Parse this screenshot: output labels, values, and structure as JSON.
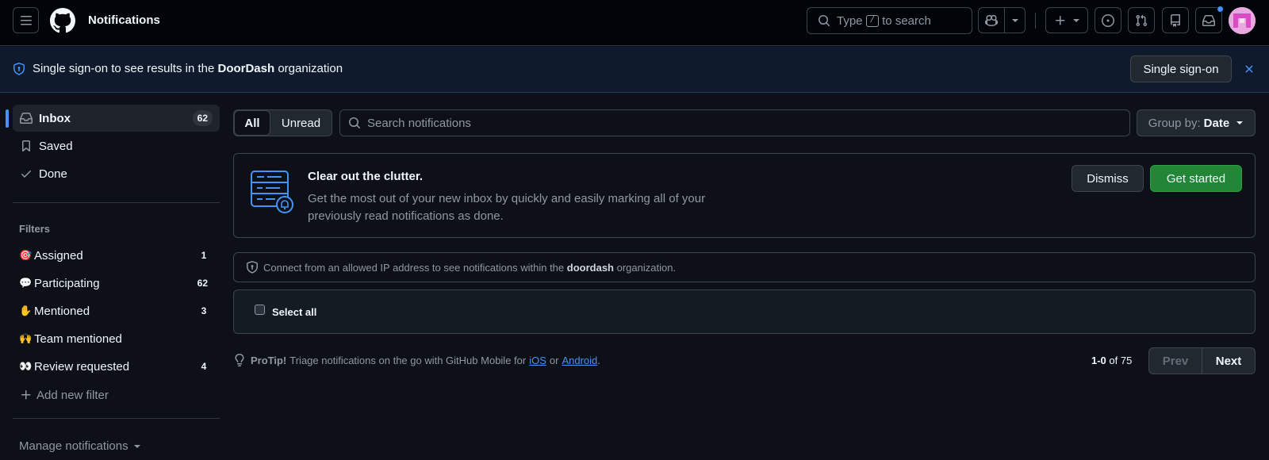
{
  "header": {
    "title": "Notifications",
    "search_prefix": "Type",
    "search_key": "/",
    "search_suffix": "to search"
  },
  "banner": {
    "text_before": "Single sign-on to see results in the",
    "org": "DoorDash",
    "text_after": "organization",
    "button": "Single sign-on"
  },
  "sidebar": {
    "items": [
      {
        "label": "Inbox",
        "count": "62"
      },
      {
        "label": "Saved"
      },
      {
        "label": "Done"
      }
    ],
    "filters_heading": "Filters",
    "filters": [
      {
        "emoji": "🎯",
        "label": "Assigned",
        "count": "1"
      },
      {
        "emoji": "💬",
        "label": "Participating",
        "count": "62"
      },
      {
        "emoji": "✋",
        "label": "Mentioned",
        "count": "3"
      },
      {
        "emoji": "🙌",
        "label": "Team mentioned"
      },
      {
        "emoji": "👀",
        "label": "Review requested",
        "count": "4"
      }
    ],
    "add_filter": "Add new filter",
    "manage": "Manage notifications"
  },
  "toolbar": {
    "tab_all": "All",
    "tab_unread": "Unread",
    "search_placeholder": "Search notifications",
    "group_by_label": "Group by:",
    "group_by_value": "Date"
  },
  "promo": {
    "title": "Clear out the clutter.",
    "body_line1": "Get the most out of your new inbox by quickly and easily marking all of your",
    "body_line2": "previously read notifications as done.",
    "dismiss": "Dismiss",
    "get_started": "Get started"
  },
  "ip_notice": {
    "text_before": "Connect from an allowed IP address to see notifications within the",
    "org": "doordash",
    "text_after": "organization."
  },
  "list": {
    "select_all": "Select all"
  },
  "footer": {
    "protip_label": "ProTip!",
    "protip_text": "Triage notifications on the go with GitHub Mobile for",
    "ios": "iOS",
    "or": "or",
    "android": "Android",
    "period": ".",
    "range": "1-0",
    "of_text": "of 75",
    "prev": "Prev",
    "next": "Next"
  },
  "colors": {
    "accent": "#4493f8",
    "success": "#238636",
    "selected_indicator": "#4493f8"
  }
}
